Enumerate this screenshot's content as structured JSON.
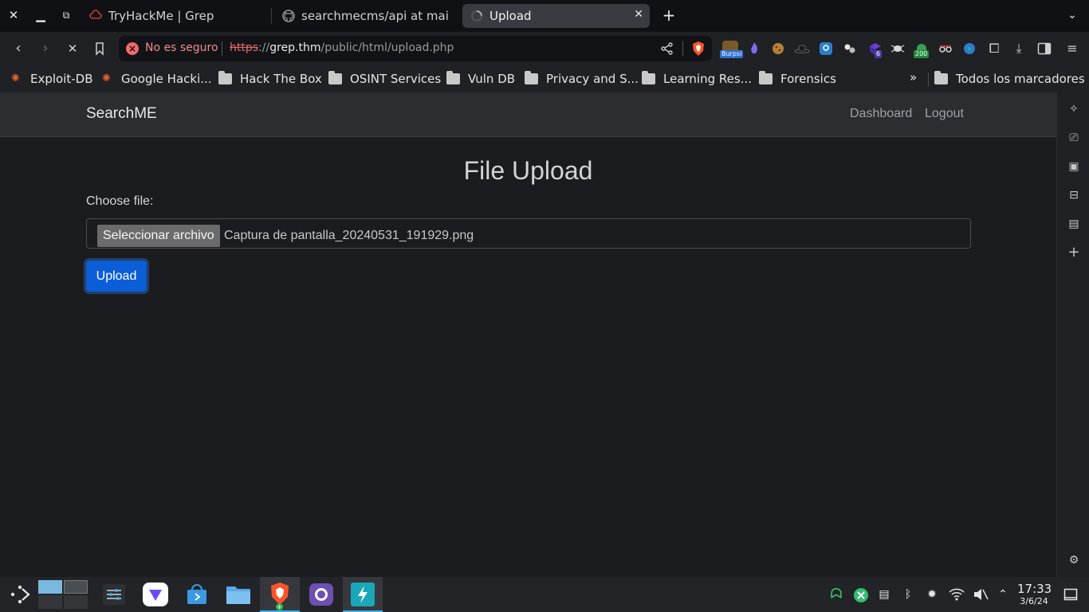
{
  "browser": {
    "tabs": [
      {
        "label": "TryHackMe | Grep",
        "icon": "tryhackme-icon"
      },
      {
        "label": "searchmecms/api at main ·",
        "icon": "github-icon"
      },
      {
        "label": "Upload",
        "icon": "loading-spinner-icon"
      }
    ],
    "security_label": "No es seguro",
    "url": {
      "scheme": "https",
      "sep": "://",
      "host": "grep.thm",
      "path": "/public/html/upload.php"
    },
    "extension_badges": {
      "burp": "Burpsi",
      "count": "6",
      "status": "200"
    }
  },
  "bookmarks": [
    {
      "label": "Exploit-DB",
      "icon": "exploitdb-icon"
    },
    {
      "label": "Google Hacki...",
      "icon": "exploitdb-icon"
    },
    {
      "label": "Hack The Box",
      "icon": "folder-icon"
    },
    {
      "label": "OSINT Services",
      "icon": "folder-icon"
    },
    {
      "label": "Vuln DB",
      "icon": "folder-icon"
    },
    {
      "label": "Privacy and S...",
      "icon": "folder-icon"
    },
    {
      "label": "Learning Res...",
      "icon": "folder-icon"
    },
    {
      "label": "Forensics",
      "icon": "folder-icon"
    }
  ],
  "bookmarks_more": "»",
  "bookmarks_all": "Todos los marcadores",
  "site": {
    "brand": "SearchME",
    "nav": {
      "dashboard": "Dashboard",
      "logout": "Logout"
    },
    "title": "File Upload",
    "choose_label": "Choose file:",
    "file_button": "Seleccionar archivo",
    "file_name": "Captura de pantalla_20240531_191929.png",
    "upload_button": "Upload"
  },
  "taskbar": {
    "time": "17:33",
    "date": "3/6/24"
  },
  "colors": {
    "accent": "#0b5ed7",
    "page_bg": "#1b1c1f",
    "navbar_bg": "#2b2d31",
    "insecure": "#f06a6a"
  }
}
